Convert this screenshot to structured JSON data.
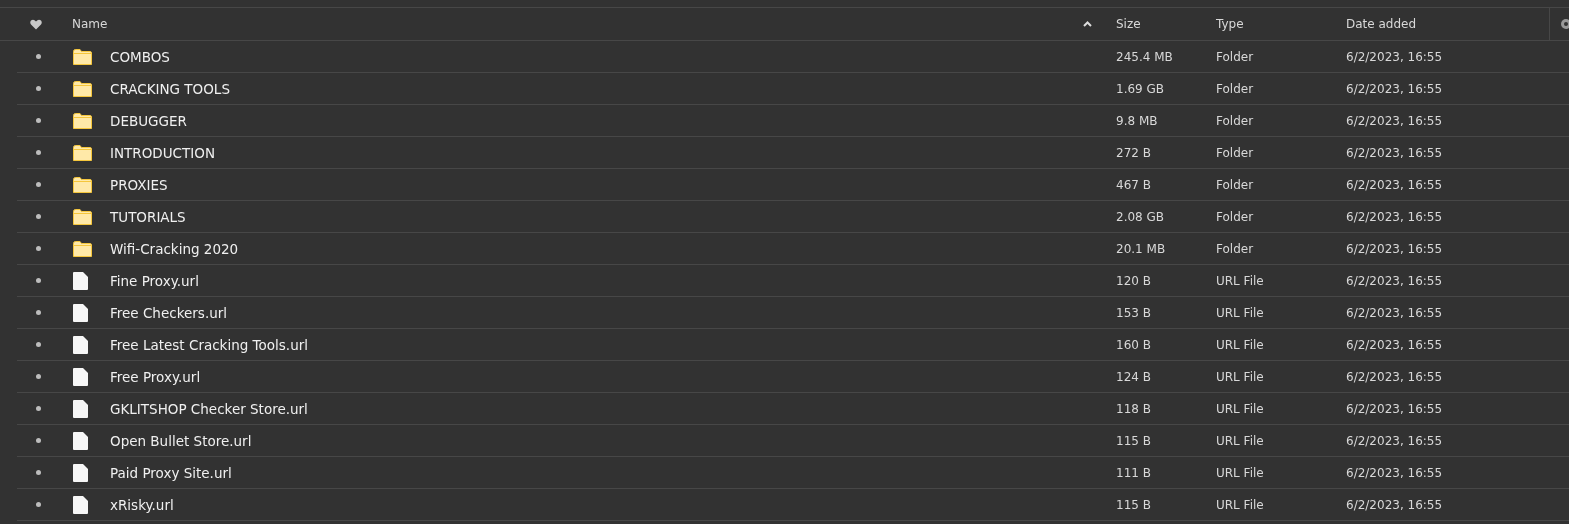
{
  "columns": {
    "name": "Name",
    "size": "Size",
    "type": "Type",
    "date": "Date added"
  },
  "rows": [
    {
      "kind": "folder",
      "name": "COMBOS",
      "size": "245.4 MB",
      "type": "Folder",
      "date": "6/2/2023, 16:55"
    },
    {
      "kind": "folder",
      "name": "CRACKING TOOLS",
      "size": "1.69 GB",
      "type": "Folder",
      "date": "6/2/2023, 16:55"
    },
    {
      "kind": "folder",
      "name": "DEBUGGER",
      "size": "9.8 MB",
      "type": "Folder",
      "date": "6/2/2023, 16:55"
    },
    {
      "kind": "folder",
      "name": "INTRODUCTION",
      "size": "272 B",
      "type": "Folder",
      "date": "6/2/2023, 16:55"
    },
    {
      "kind": "folder",
      "name": "PROXIES",
      "size": "467 B",
      "type": "Folder",
      "date": "6/2/2023, 16:55"
    },
    {
      "kind": "folder",
      "name": "TUTORIALS",
      "size": "2.08 GB",
      "type": "Folder",
      "date": "6/2/2023, 16:55"
    },
    {
      "kind": "folder",
      "name": "Wifi-Cracking 2020",
      "size": "20.1 MB",
      "type": "Folder",
      "date": "6/2/2023, 16:55"
    },
    {
      "kind": "file",
      "name": "Fine Proxy.url",
      "size": "120 B",
      "type": "URL File",
      "date": "6/2/2023, 16:55"
    },
    {
      "kind": "file",
      "name": "Free Checkers.url",
      "size": "153 B",
      "type": "URL File",
      "date": "6/2/2023, 16:55"
    },
    {
      "kind": "file",
      "name": "Free Latest Cracking Tools.url",
      "size": "160 B",
      "type": "URL File",
      "date": "6/2/2023, 16:55"
    },
    {
      "kind": "file",
      "name": "Free Proxy.url",
      "size": "124 B",
      "type": "URL File",
      "date": "6/2/2023, 16:55"
    },
    {
      "kind": "file",
      "name": "GKLITSHOP Checker Store.url",
      "size": "118 B",
      "type": "URL File",
      "date": "6/2/2023, 16:55"
    },
    {
      "kind": "file",
      "name": "Open Bullet Store.url",
      "size": "115 B",
      "type": "URL File",
      "date": "6/2/2023, 16:55"
    },
    {
      "kind": "file",
      "name": "Paid Proxy Site.url",
      "size": "111 B",
      "type": "URL File",
      "date": "6/2/2023, 16:55"
    },
    {
      "kind": "file",
      "name": "xRisky.url",
      "size": "115 B",
      "type": "URL File",
      "date": "6/2/2023, 16:55"
    }
  ]
}
